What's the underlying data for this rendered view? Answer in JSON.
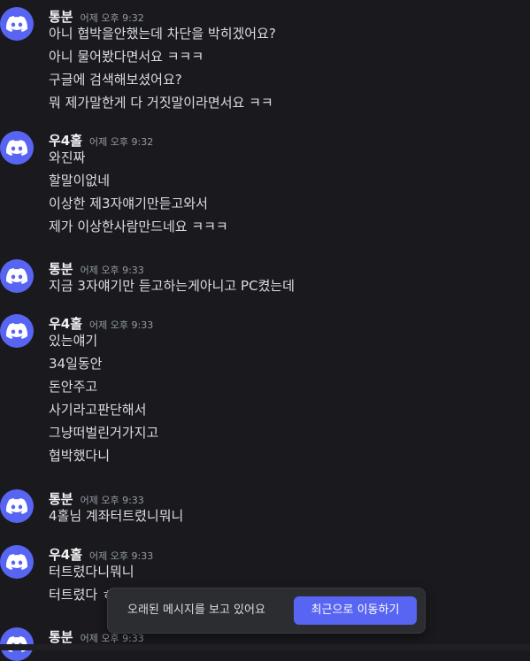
{
  "colors": {
    "background": "#1a1a1e",
    "avatar": "#5865f2",
    "accent_button": "#5865f2",
    "toast_background": "#2b2d31",
    "text": "#dbdee1",
    "muted": "#949ba4"
  },
  "messages": [
    {
      "author": "통분",
      "time": "어제 오후 9:32",
      "avatar_icon": "discord-logo-icon",
      "lines": [
        "아니 협박을안했는데 차단을 박히겠어요?",
        "아니 물어봤다면서요 ㅋㅋㅋ",
        "구글에 검색해보셨어요?",
        "뭐 제가말한게 다 거짓말이라면서요 ㅋㅋ"
      ]
    },
    {
      "author": "우4홀",
      "time": "어제 오후 9:32",
      "avatar_icon": "discord-logo-icon",
      "lines": [
        "와진짜",
        "할말이없네",
        "이상한 제3자얘기만듣고와서",
        "제가 이상한사람만드네요 ㅋㅋㅋ"
      ]
    },
    {
      "author": "통분",
      "time": "어제 오후 9:33",
      "avatar_icon": "discord-logo-icon",
      "lines": [
        "지금 3자얘기만 듣고하는게아니고 PC켰는데"
      ]
    },
    {
      "author": "우4홀",
      "time": "어제 오후 9:33",
      "avatar_icon": "discord-logo-icon",
      "lines": [
        "있는얘기",
        "34일동안",
        "돈안주고",
        "사기라고판단해서",
        "그냥떠벌린거가지고",
        "협박했다니"
      ]
    },
    {
      "author": "통분",
      "time": "어제 오후 9:33",
      "avatar_icon": "discord-logo-icon",
      "lines": [
        "4홀님 계좌터트렸니뭐니"
      ]
    },
    {
      "author": "우4홀",
      "time": "어제 오후 9:33",
      "avatar_icon": "discord-logo-icon",
      "lines": [
        "터트렸다니뭐니",
        "터트렸다 ㅎ"
      ]
    },
    {
      "author": "통분",
      "time": "어제 오후 9:33",
      "avatar_icon": "discord-logo-icon",
      "lines": []
    }
  ],
  "toast": {
    "text": "오래된 메시지를 보고 있어요",
    "button_label": "최근으로 이동하기"
  }
}
